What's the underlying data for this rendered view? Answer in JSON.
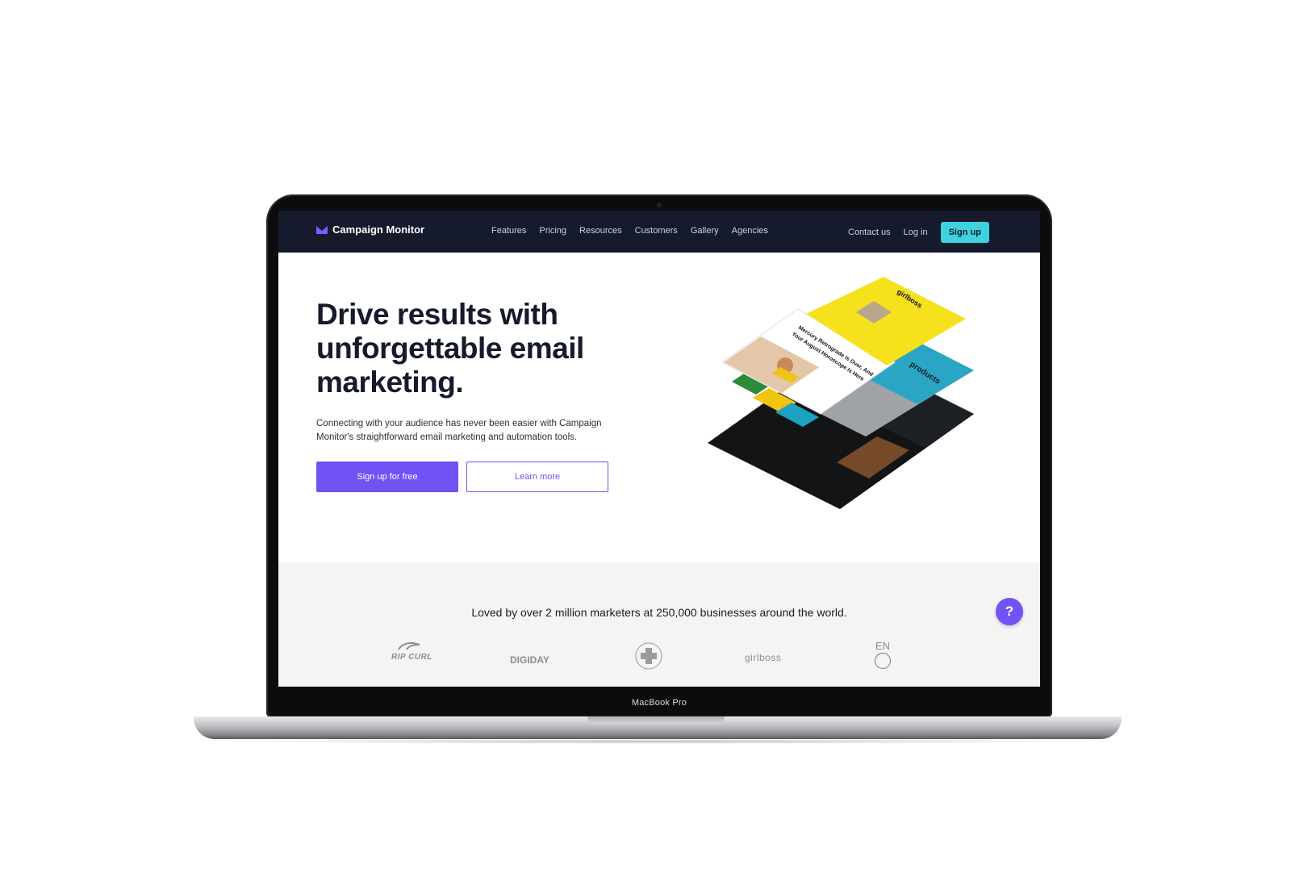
{
  "device": {
    "model_label": "MacBook Pro"
  },
  "nav": {
    "brand": "Campaign Monitor",
    "links": [
      "Features",
      "Pricing",
      "Resources",
      "Customers",
      "Gallery",
      "Agencies"
    ],
    "contact": "Contact us",
    "login": "Log in",
    "signup": "Sign up"
  },
  "hero": {
    "headline": "Drive results with unforgettable email marketing.",
    "subcopy": "Connecting with your audience has never been easier with Campaign Monitor's straightforward email marketing and automation tools.",
    "primary_cta": "Sign up for free",
    "secondary_cta": "Learn more",
    "illustration": {
      "brand_text": "girlboss",
      "article_title": "Mercury Retrograde Is Over, And Your August Horoscope Is Here",
      "products_text": "products"
    }
  },
  "social_proof": {
    "tagline": "Loved by over 2 million marketers at 250,000 businesses around the world.",
    "logos": [
      "RIP CURL",
      "DIGIDAY",
      "AUSTRALIAN RED CROSS",
      "girlboss",
      "EN"
    ]
  },
  "help": {
    "label": "?"
  },
  "colors": {
    "nav_bg": "#151a2c",
    "accent": "#7251f5",
    "signup": "#3ed2de",
    "social_bg": "#f4f4f4"
  }
}
